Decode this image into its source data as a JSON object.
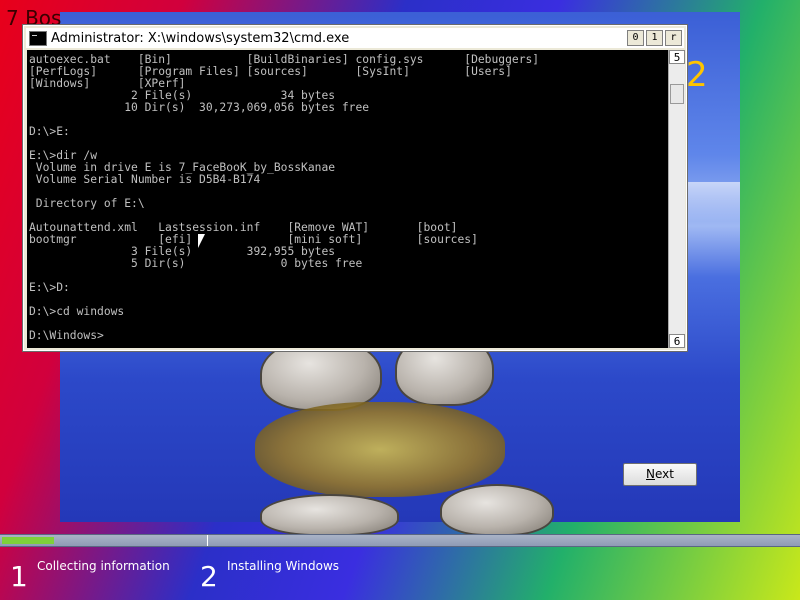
{
  "corner_text": "7 Bos",
  "side_digit": "2",
  "cmd": {
    "title": "Administrator: X:\\windows\\system32\\cmd.exe",
    "buttons": {
      "minimize": "0",
      "maximize": "1",
      "close": "r"
    },
    "scroll_up": "5",
    "scroll_down": "6",
    "lines": [
      "autoexec.bat    [Bin]           [BuildBinaries] config.sys      [Debuggers]",
      "[PerfLogs]      [Program Files] [sources]       [SysInt]        [Users]",
      "[Windows]       [XPerf]",
      "               2 File(s)             34 bytes",
      "              10 Dir(s)  30,273,069,056 bytes free",
      "",
      "D:\\>E:",
      "",
      "E:\\>dir /w",
      " Volume in drive E is 7_FaceBooK_by_BossKanae",
      " Volume Serial Number is D5B4-B174",
      "",
      " Directory of E:\\",
      "",
      "Autounattend.xml   Lastsession.inf    [Remove WAT]       [boot]",
      "bootmgr            [efi]              [mini soft]        [sources]",
      "               3 File(s)        392,955 bytes",
      "               5 Dir(s)              0 bytes free",
      "",
      "E:\\>D:",
      "",
      "D:\\>cd windows",
      "",
      "D:\\Windows>"
    ]
  },
  "next_button": {
    "label": "Next",
    "accent_letter": "N",
    "rest": "ext"
  },
  "progress": {
    "fill_fraction": 0.065,
    "fill_color": "#7ed03a"
  },
  "steps": [
    {
      "number": "1",
      "label": "Collecting information"
    },
    {
      "number": "2",
      "label": "Installing Windows"
    }
  ]
}
